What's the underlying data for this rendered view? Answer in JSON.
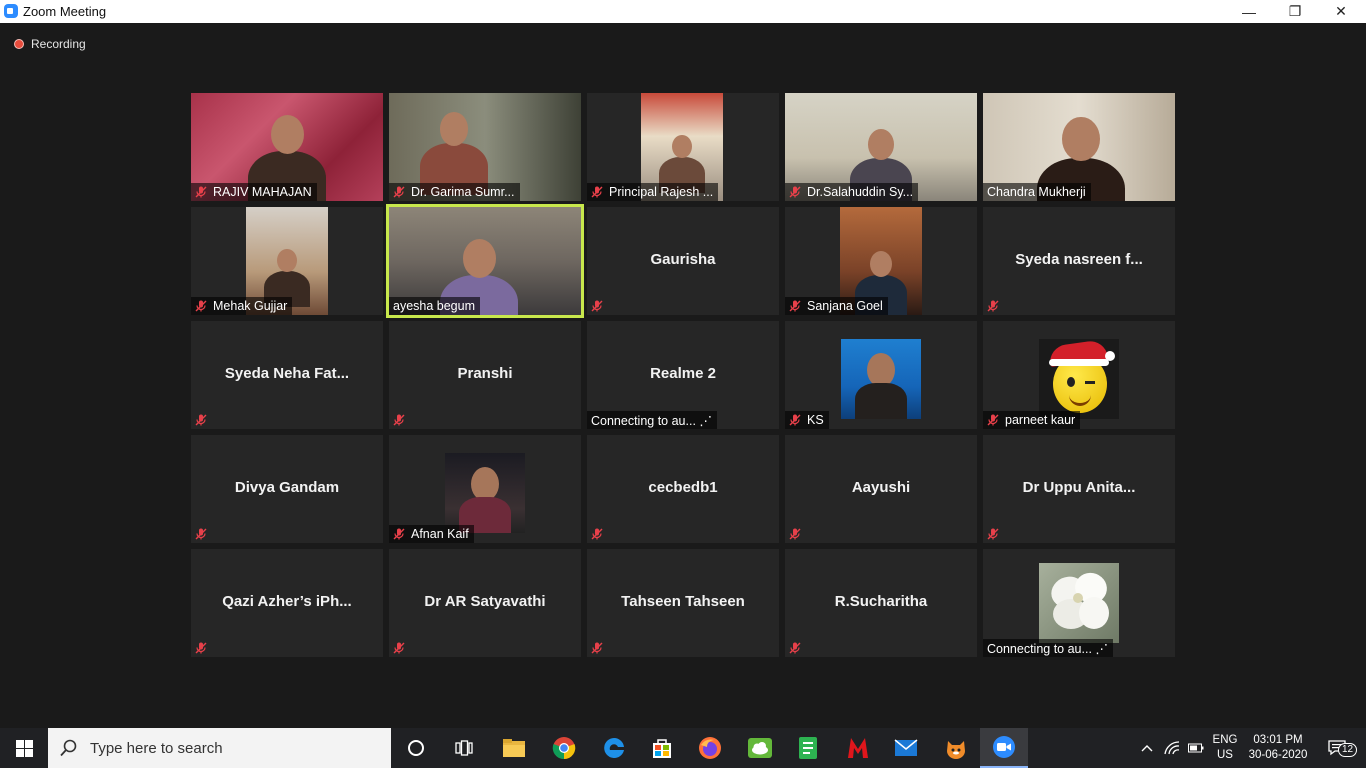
{
  "window": {
    "title": "Zoom Meeting",
    "minimize_glyph": "—",
    "restore_glyph": "❐",
    "close_glyph": "✕"
  },
  "recording": {
    "label": "Recording"
  },
  "participants": [
    {
      "name": "RAJIV MAHAJAN",
      "video": true,
      "muted": true
    },
    {
      "name": "Dr. Garima Sumr...",
      "video": true,
      "muted": true
    },
    {
      "name": "Principal Rajesh ...",
      "video": true,
      "muted": true
    },
    {
      "name": "Dr.Salahuddin Sy...",
      "video": true,
      "muted": true
    },
    {
      "name": "Chandra Mukherji",
      "video": true,
      "muted": false
    },
    {
      "name": "Mehak Gujjar",
      "video": true,
      "muted": true
    },
    {
      "name": "ayesha begum",
      "video": true,
      "muted": false,
      "active_speaker": true
    },
    {
      "name": "Gaurisha",
      "video": false,
      "muted": true
    },
    {
      "name": "Sanjana Goel",
      "video": true,
      "muted": true
    },
    {
      "name": "Syeda nasreen f...",
      "video": false,
      "muted": true
    },
    {
      "name": "Syeda Neha Fat...",
      "video": false,
      "muted": true
    },
    {
      "name": "Pranshi",
      "video": false,
      "muted": true
    },
    {
      "name": "Realme 2",
      "video": false,
      "muted": false,
      "status": "Connecting to au... ⋰"
    },
    {
      "name": "KS",
      "video": false,
      "muted": true,
      "avatar": "profile-photo"
    },
    {
      "name": "parneet kaur",
      "video": false,
      "muted": true,
      "avatar": "emoji-santa-hat"
    },
    {
      "name": "Divya Gandam",
      "video": false,
      "muted": true
    },
    {
      "name": "Afnan Kaif",
      "video": false,
      "muted": true,
      "avatar": "profile-photo-night"
    },
    {
      "name": "cecbedb1",
      "video": false,
      "muted": true
    },
    {
      "name": "Aayushi",
      "video": false,
      "muted": true
    },
    {
      "name": "Dr Uppu Anita...",
      "video": false,
      "muted": true
    },
    {
      "name": "Qazi Azher’s iPh...",
      "video": false,
      "muted": true
    },
    {
      "name": "Dr AR Satyavathi",
      "video": false,
      "muted": true
    },
    {
      "name": "Tahseen Tahseen",
      "video": false,
      "muted": true
    },
    {
      "name": "R.Sucharitha",
      "video": false,
      "muted": true
    },
    {
      "name": "",
      "video": false,
      "muted": false,
      "avatar": "white-flower",
      "status": "Connecting to au... ⋰"
    }
  ],
  "taskbar": {
    "search_placeholder": "Type here to search",
    "language_top": "ENG",
    "language_bottom": "US",
    "time": "03:01 PM",
    "date": "30-06-2020",
    "notification_count": "12"
  },
  "colors": {
    "active_speaker_border": "#c8e84c",
    "muted_icon": "#e8404a",
    "tile_bg": "#262626",
    "window_bg": "#1a1a1a"
  }
}
